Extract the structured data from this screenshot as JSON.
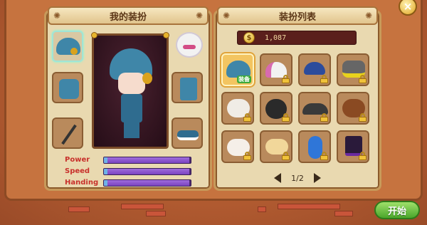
{
  "close_button": {
    "label": "×"
  },
  "left_panel": {
    "title": "我的装扮",
    "stats": [
      {
        "label": "Power",
        "level": 0.98
      },
      {
        "label": "Speed",
        "level": 0.98
      },
      {
        "label": "Handing",
        "level": 0.98
      }
    ]
  },
  "right_panel": {
    "title": "装扮列表",
    "coins": "1,087",
    "coin_symbol": "$",
    "equipped_badge": "装备",
    "pager": {
      "current": "1/2"
    }
  },
  "start_button": {
    "label": "开始"
  },
  "colors": {
    "accent": "#e9d9b0",
    "stat_fill": "#7a43c0",
    "start_button": "#4aa62b",
    "background": "#b05a30"
  },
  "icons": [
    "close-icon",
    "coin-icon",
    "lock-icon",
    "arrow-left-icon",
    "arrow-right-icon"
  ]
}
